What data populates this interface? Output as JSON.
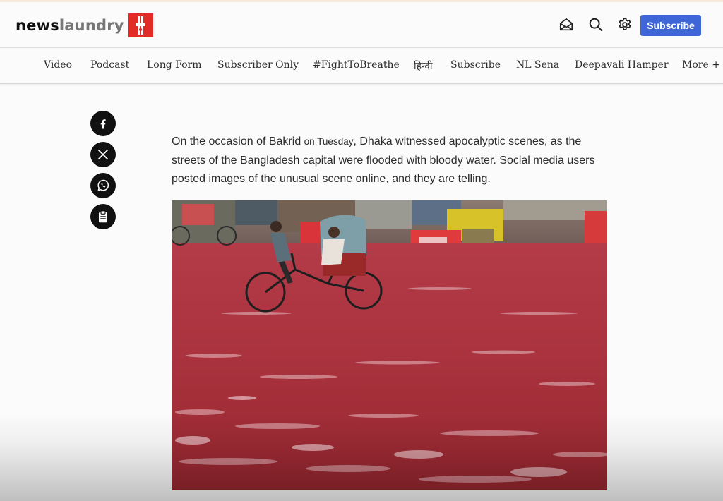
{
  "logo": {
    "news": "news",
    "laundry": "laundry"
  },
  "header": {
    "subscribe_label": "Subscribe"
  },
  "icons": {
    "inbox": "envelope-open-icon",
    "search": "search-icon",
    "settings": "gear-icon"
  },
  "nav": {
    "items": [
      "Video",
      "Podcast",
      "Long Form",
      "Subscriber Only",
      "#FightToBreathe",
      "हिन्दी",
      "Subscribe",
      "NL Sena",
      "Deepavali Hamper",
      "More +"
    ]
  },
  "share": [
    "facebook-icon",
    "x-icon",
    "whatsapp-icon",
    "clipboard-icon"
  ],
  "article": {
    "p1_a": "On the occasion of Bakrid ",
    "p1_b": "on Tuesday",
    "p1_c": ", Dhaka witnessed apocalyptic scenes, as the streets of the Bangladesh capital were flooded with bloody water. Social media users posted images of the unusual scene online, and they are telling."
  },
  "colors": {
    "brand_red": "#e02b27",
    "subscribe_blue": "#3f66d6",
    "flood_red": "#a8323d"
  }
}
